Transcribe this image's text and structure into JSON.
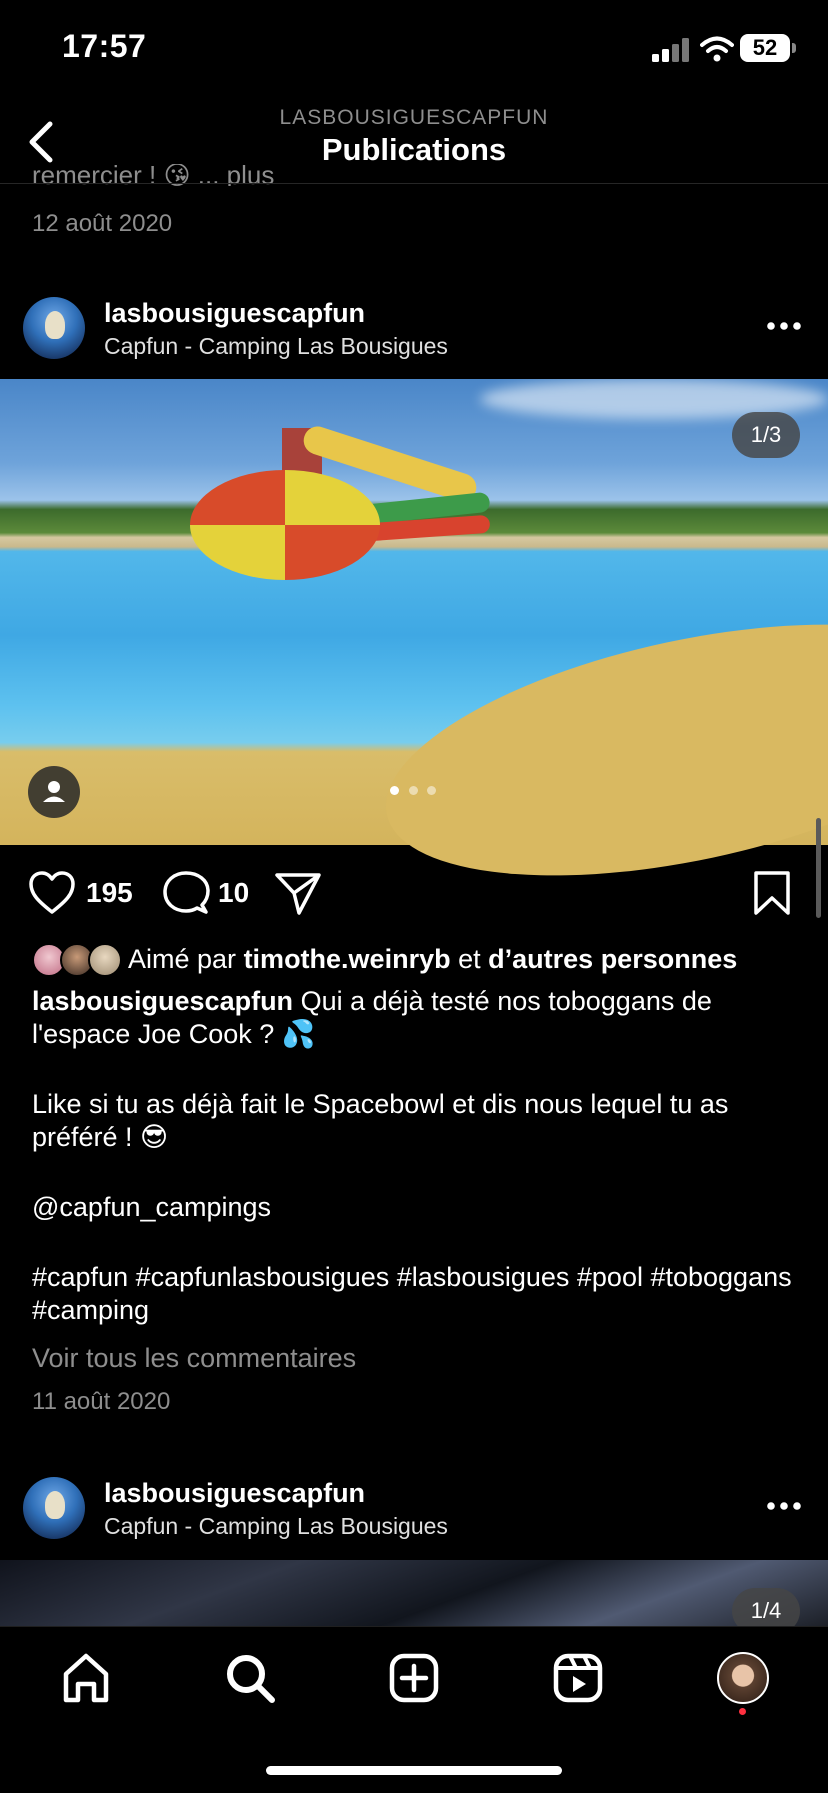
{
  "status_bar": {
    "time": "17:57",
    "battery": "52"
  },
  "header": {
    "subtitle": "LASBOUSIGUESCAPFUN",
    "title": "Publications"
  },
  "previous_post": {
    "caption_tail": "remercier ! 😘 ... plus",
    "date": "12 août 2020"
  },
  "post": {
    "username": "lasbousiguescapfun",
    "location": "Capfun - Camping Las Bousigues",
    "media_counter": "1/3",
    "likes": "195",
    "comments": "10",
    "liked_by_prefix": "Aimé par",
    "liked_by_user": "timothe.weinryb",
    "liked_by_and": "et",
    "liked_by_others": "d’autres personnes",
    "caption_user": "lasbousiguescapfun",
    "caption_line1": "Qui a déjà testé nos toboggans de l'espace Joe Cook ? 💦",
    "caption_line2": "Like si tu as déjà fait le Spacebowl et dis nous lequel tu as préféré ! 😎",
    "caption_mention": "@capfun_campings",
    "caption_tags": "#capfun #capfunlasbousigues #lasbousigues #pool #toboggans #camping",
    "view_comments": "Voir tous les commentaires",
    "date": "11 août 2020"
  },
  "next_post": {
    "username": "lasbousiguescapfun",
    "location": "Capfun - Camping Las Bousigues",
    "media_counter": "1/4"
  },
  "icons": [
    "back-icon",
    "more-icon",
    "heart-icon",
    "comment-icon",
    "share-icon",
    "bookmark-icon",
    "home-icon",
    "search-icon",
    "create-icon",
    "reels-icon",
    "profile-icon"
  ]
}
